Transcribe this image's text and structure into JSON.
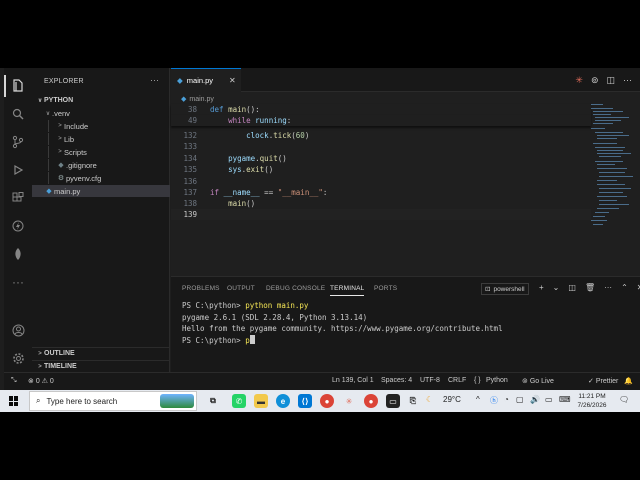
{
  "sidebar": {
    "title": "EXPLORER",
    "more": "···",
    "project": "PYTHON",
    "tree": [
      {
        "label": ".venv",
        "depth": 1,
        "chevron": "∨"
      },
      {
        "label": "Include",
        "depth": 2,
        "chevron": ">"
      },
      {
        "label": "Lib",
        "depth": 2,
        "chevron": ">"
      },
      {
        "label": "Scripts",
        "depth": 2,
        "chevron": ">"
      },
      {
        "label": ".gitignore",
        "depth": 2,
        "chevron": ""
      },
      {
        "label": "pyvenv.cfg",
        "depth": 2,
        "chevron": ""
      },
      {
        "label": "main.py",
        "depth": 1,
        "chevron": ""
      }
    ],
    "outline": "OUTLINE",
    "timeline": "TIMELINE"
  },
  "editor": {
    "tab_label": "main.py",
    "breadcrumb": "main.py",
    "lines": [
      {
        "n": "38",
        "code": "def main():"
      },
      {
        "n": "49",
        "code": "    while running:"
      },
      {
        "n": "132",
        "code": "        clock.tick(60)"
      },
      {
        "n": "133",
        "code": ""
      },
      {
        "n": "134",
        "code": "    pygame.quit()"
      },
      {
        "n": "135",
        "code": "    sys.exit()"
      },
      {
        "n": "136",
        "code": ""
      },
      {
        "n": "137",
        "code": "if __name__ == \"__main__\":"
      },
      {
        "n": "138",
        "code": "    main()"
      },
      {
        "n": "139",
        "code": ""
      }
    ]
  },
  "panel": {
    "tabs": [
      "PROBLEMS",
      "OUTPUT",
      "DEBUG CONSOLE",
      "TERMINAL",
      "PORTS"
    ],
    "active_tab": "TERMINAL",
    "shell": "powershell",
    "terminal": {
      "prompt": "PS C:\\python>",
      "command": "python main.py",
      "out1": "pygame 2.6.1 (SDL 2.28.4, Python 3.13.14)",
      "out2": "Hello from the pygame community. https://www.pygame.org/contribute.html",
      "typed": "p"
    }
  },
  "statusbar": {
    "errors": "0",
    "warnings": "0",
    "position": "Ln 139, Col 1",
    "spaces": "Spaces: 4",
    "encoding": "UTF-8",
    "eol": "CRLF",
    "braces": "{ }",
    "language": "Python",
    "golive": "Go Live",
    "prettier": "Prettier"
  },
  "taskbar": {
    "search_placeholder": "Type here to search",
    "temperature": "29°C",
    "time": "11:21 PM",
    "date": "7/26/2026"
  },
  "colors": {
    "accent": "#0078d4",
    "editor_bg": "#1f1f1f",
    "sidebar_bg": "#181818"
  }
}
